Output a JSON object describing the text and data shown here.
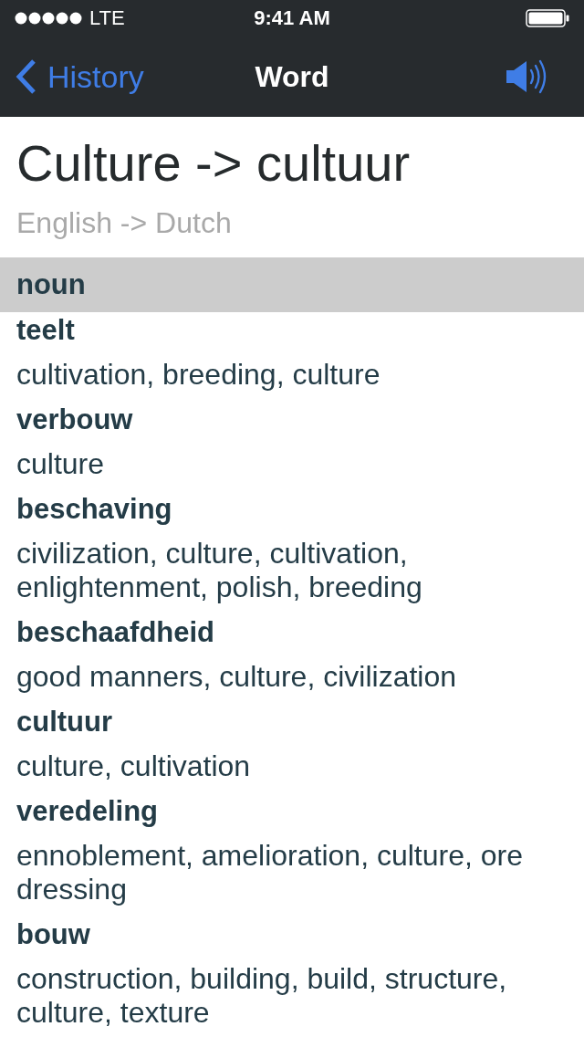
{
  "status_bar": {
    "carrier": "LTE",
    "time": "9:41 AM"
  },
  "nav_bar": {
    "back_label": "History",
    "title": "Word"
  },
  "header": {
    "title": "Culture -> cultuur",
    "subtitle": "English -> Dutch"
  },
  "sections": [
    {
      "label": "noun",
      "entries": [
        {
          "word": "teelt",
          "translation": "cultivation, breeding, culture"
        },
        {
          "word": "verbouw",
          "translation": "culture"
        },
        {
          "word": "beschaving",
          "translation": "civilization, culture, cultivation, enlightenment, polish, breeding"
        },
        {
          "word": "beschaafdheid",
          "translation": "good manners, culture, civilization"
        },
        {
          "word": "cultuur",
          "translation": "culture, cultivation"
        },
        {
          "word": "veredeling",
          "translation": "ennoblement, amelioration, culture, ore dressing"
        },
        {
          "word": "bouw",
          "translation": "construction, building, build, structure, culture, texture"
        }
      ]
    }
  ]
}
